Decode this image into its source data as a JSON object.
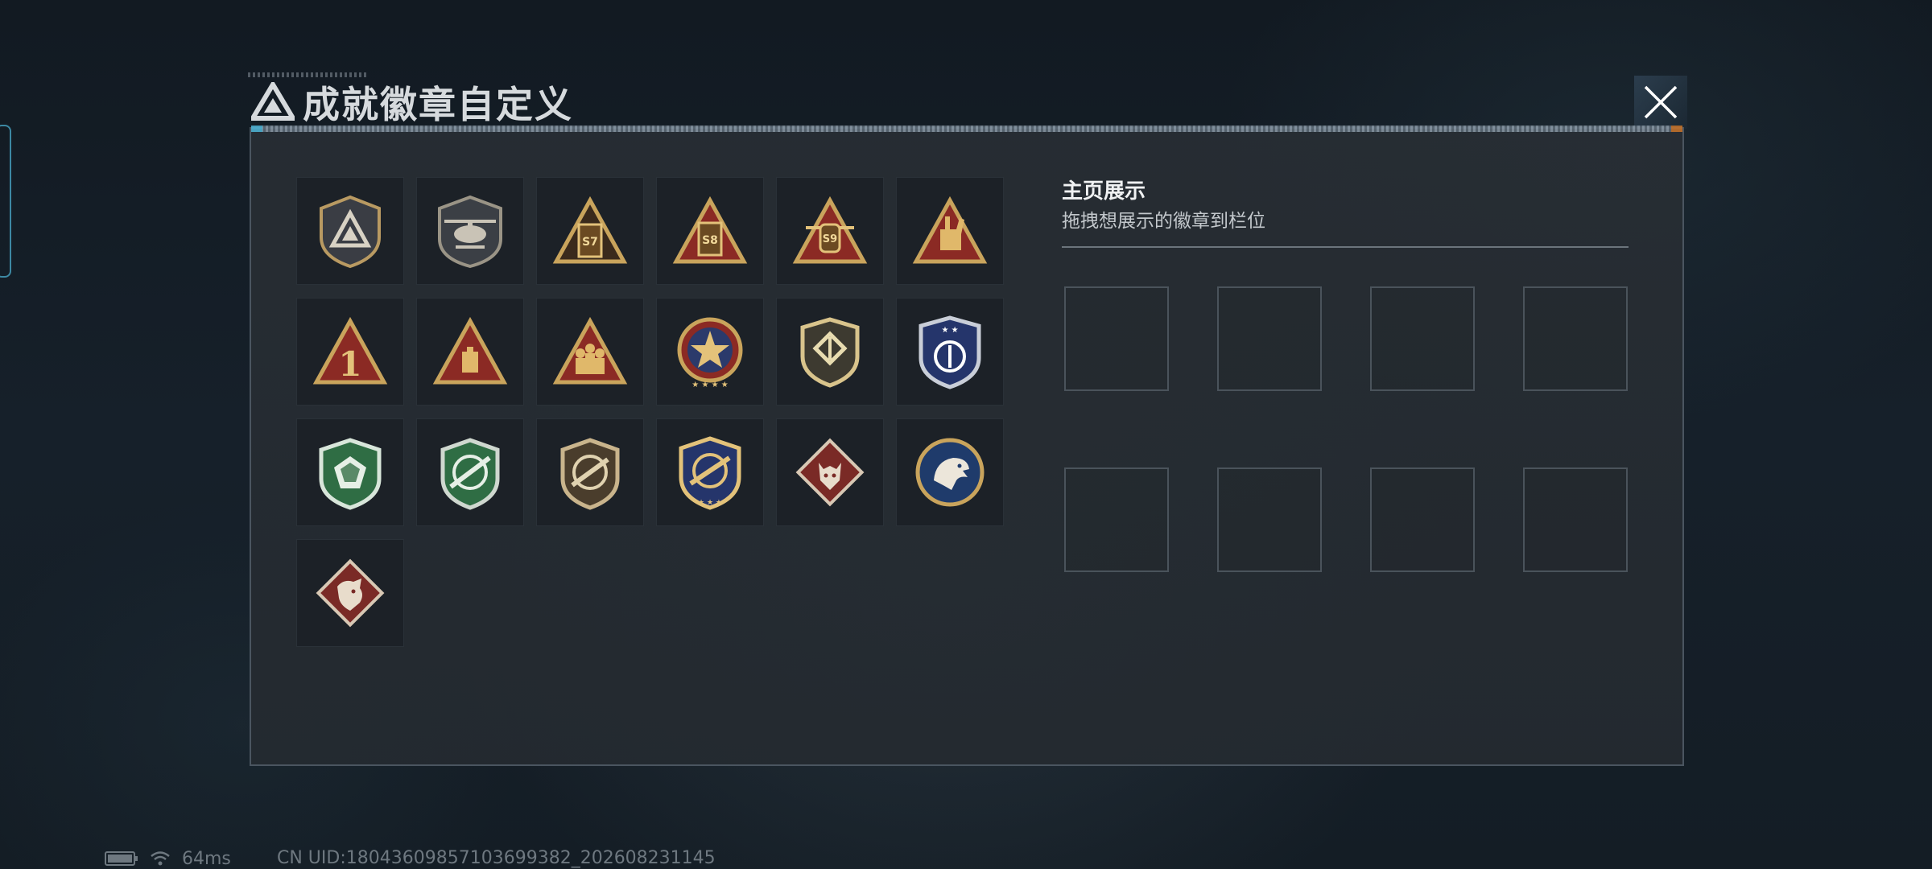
{
  "window": {
    "title": "成就徽章自定义",
    "close_label": "close"
  },
  "badges": [
    {
      "name": "triangle-shield-badge"
    },
    {
      "name": "helicopter-badge"
    },
    {
      "name": "s7-badge",
      "text": "S7"
    },
    {
      "name": "s8-badge",
      "text": "S8"
    },
    {
      "name": "s9-badge",
      "text": "S9"
    },
    {
      "name": "hand-sign-badge"
    },
    {
      "name": "number-one-badge",
      "text": "1"
    },
    {
      "name": "crate-badge"
    },
    {
      "name": "soldiers-badge"
    },
    {
      "name": "star-medal-badge"
    },
    {
      "name": "gold-shield-badge"
    },
    {
      "name": "blue-shield-badge"
    },
    {
      "name": "green-diamond-badge"
    },
    {
      "name": "green-rifle-badge"
    },
    {
      "name": "rifle-badge"
    },
    {
      "name": "gold-rifle-badge"
    },
    {
      "name": "wolf-badge"
    },
    {
      "name": "eagle-badge"
    },
    {
      "name": "dragon-badge"
    }
  ],
  "showcase": {
    "title": "主页展示",
    "hint": "拖拽想展示的徽章到栏位",
    "slots": 8
  },
  "status": {
    "battery_icon": "battery-icon",
    "wifi_icon": "wifi-icon",
    "ping": "64ms",
    "uid": "CN UID:18043609857103699382_202608231145"
  },
  "colors": {
    "gold": "#c9a45c",
    "red": "#8b2a24",
    "green": "#2f6d44",
    "blue": "#25356b",
    "accent": "#4fb6d8"
  }
}
